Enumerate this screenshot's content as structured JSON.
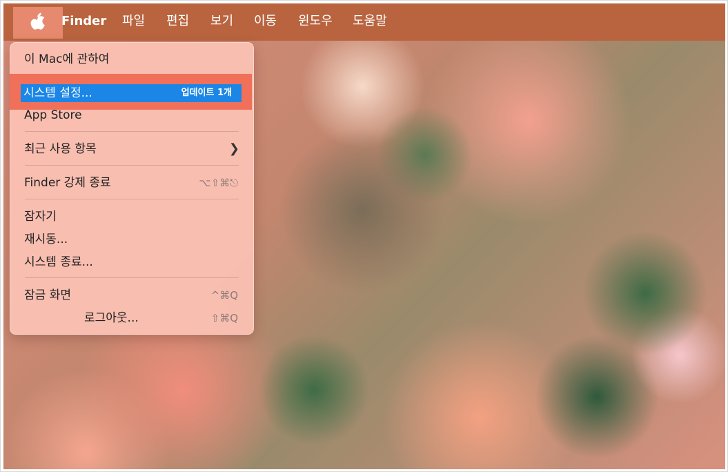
{
  "menubar": {
    "app_name": "Finder",
    "menus": [
      "파일",
      "편집",
      "보기",
      "이동",
      "윈도우",
      "도움말"
    ]
  },
  "apple_menu": {
    "about": "이 Mac에 관하여",
    "system_settings": "시스템 설정...",
    "update_badge": "업데이트 1개",
    "app_store": "App Store",
    "recent_items": "최근 사용 항목",
    "force_quit": "Finder 강제 종료",
    "force_quit_shortcut": "⌥⇧⌘⎋",
    "sleep": "잠자기",
    "restart": "재시동...",
    "shutdown": "시스템 종료...",
    "lock_screen": "잠금 화면",
    "lock_screen_shortcut": "^⌘Q",
    "logout": "로그아웃...",
    "logout_shortcut": "⇧⌘Q"
  },
  "colors": {
    "menubar": "#b9643f",
    "highlight": "#f0705a",
    "selection": "#1b86e6"
  }
}
